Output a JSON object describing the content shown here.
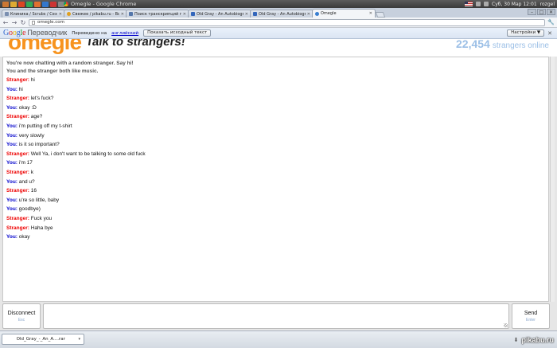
{
  "system_bar": {
    "window_title": "Omegle - Google Chrome",
    "datetime": "Суб, 30 Мар 12:01",
    "user": "rozgel"
  },
  "tabs": [
    {
      "label": "Клиника / Scrubs / Сезон",
      "favicon_color": "#7a8fb0",
      "active": false
    },
    {
      "label": "Свежее / pikabu.ru - Все",
      "favicon_color": "#e0a020",
      "active": false
    },
    {
      "label": "Поиск транскрипций по",
      "favicon_color": "#5577aa",
      "active": false
    },
    {
      "label": "Old Gray - An Autobiograp",
      "favicon_color": "#3366bb",
      "active": false
    },
    {
      "label": "Old Gray - An Autobiograp",
      "favicon_color": "#3366bb",
      "active": false
    },
    {
      "label": "Omegle",
      "favicon_color": "#3a7fd0",
      "active": true
    }
  ],
  "toolbar": {
    "url": "omegle.com"
  },
  "translate_bar": {
    "logo_google": "Google",
    "logo_product": "Переводчик",
    "translated_to_label": "Переведено на",
    "language": "английский",
    "show_original_label": "Показать исходный текст",
    "settings_label": "Настройки ▼"
  },
  "omegle_header": {
    "logo": "omegle",
    "tagline": "Talk to strangers!",
    "online_count": "22,454",
    "online_text": "strangers online"
  },
  "chat": {
    "system_messages": [
      "You're now chatting with a random stranger. Say hi!",
      "You and the stranger both like music."
    ],
    "messages": [
      {
        "who": "Stranger:",
        "role": "stranger",
        "text": "hi"
      },
      {
        "who": "You:",
        "role": "you",
        "text": "hi"
      },
      {
        "who": "Stranger:",
        "role": "stranger",
        "text": "let's fuck?"
      },
      {
        "who": "You:",
        "role": "you",
        "text": "okay :D"
      },
      {
        "who": "Stranger:",
        "role": "stranger",
        "text": "age?"
      },
      {
        "who": "You:",
        "role": "you",
        "text": "i'm putting off my t-shirt"
      },
      {
        "who": "You:",
        "role": "you",
        "text": "very slowly"
      },
      {
        "who": "You:",
        "role": "you",
        "text": "is it so important?"
      },
      {
        "who": "Stranger:",
        "role": "stranger",
        "text": "Well Ya, i don't want to be talking to some old fuck"
      },
      {
        "who": "You:",
        "role": "you",
        "text": "i'm 17"
      },
      {
        "who": "Stranger:",
        "role": "stranger",
        "text": "k"
      },
      {
        "who": "You:",
        "role": "you",
        "text": "and u?"
      },
      {
        "who": "Stranger:",
        "role": "stranger",
        "text": "16"
      },
      {
        "who": "You:",
        "role": "you",
        "text": "u're so little, baby"
      },
      {
        "who": "You:",
        "role": "you",
        "text": "goodbye)"
      },
      {
        "who": "Stranger:",
        "role": "stranger",
        "text": "Fuck you"
      },
      {
        "who": "Stranger:",
        "role": "stranger",
        "text": "Haha bye"
      },
      {
        "who": "You:",
        "role": "you",
        "text": "okay"
      }
    ]
  },
  "controls": {
    "disconnect_label": "Disconnect",
    "disconnect_hint": "Esc",
    "send_label": "Send",
    "send_hint": "Enter",
    "message_value": ""
  },
  "downloads": {
    "file_name": "Old_Gray_-_An_A....rar",
    "watermark": "pikabu.ru"
  },
  "colors": {
    "stranger": "#ee0000",
    "you": "#0000cc",
    "omegle_orange": "#f7931e",
    "online_blue": "#9bbfe6"
  }
}
